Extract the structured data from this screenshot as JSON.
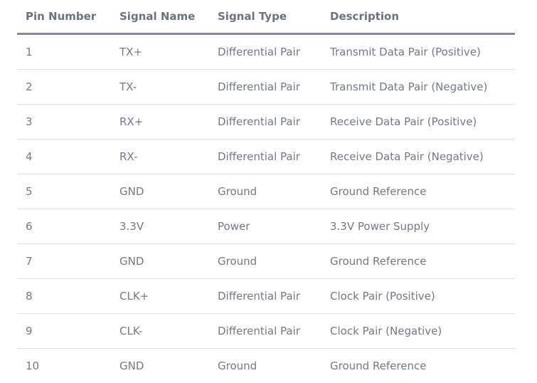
{
  "table": {
    "headers": [
      "Pin Number",
      "Signal Name",
      "Signal Type",
      "Description"
    ],
    "rows": [
      [
        "1",
        "TX+",
        "Differential Pair",
        "Transmit Data Pair (Positive)"
      ],
      [
        "2",
        "TX-",
        "Differential Pair",
        "Transmit Data Pair (Negative)"
      ],
      [
        "3",
        "RX+",
        "Differential Pair",
        "Receive Data Pair (Positive)"
      ],
      [
        "4",
        "RX-",
        "Differential Pair",
        "Receive Data Pair (Negative)"
      ],
      [
        "5",
        "GND",
        "Ground",
        "Ground Reference"
      ],
      [
        "6",
        "3.3V",
        "Power",
        "3.3V Power Supply"
      ],
      [
        "7",
        "GND",
        "Ground",
        "Ground Reference"
      ],
      [
        "8",
        "CLK+",
        "Differential Pair",
        "Clock Pair (Positive)"
      ],
      [
        "9",
        "CLK-",
        "Differential Pair",
        "Clock Pair (Negative)"
      ],
      [
        "10",
        "GND",
        "Ground",
        "Ground Reference"
      ]
    ]
  }
}
